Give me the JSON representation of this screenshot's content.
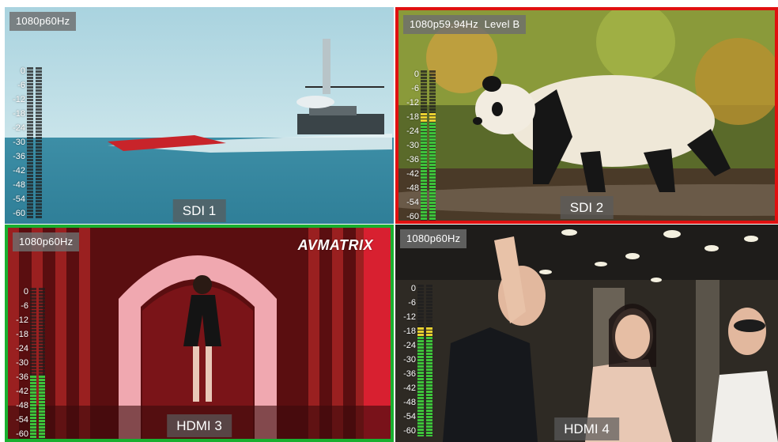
{
  "panes": [
    {
      "id": "sdi1",
      "format": "1080p60Hz",
      "source": "SDI 1",
      "audio_level": [
        0.0,
        0.0
      ]
    },
    {
      "id": "sdi2",
      "format": "1080p59.94Hz  Level B",
      "source": "SDI 2",
      "audio_level": [
        0.72,
        0.72
      ]
    },
    {
      "id": "hdmi3",
      "format": "1080p60Hz",
      "source": "HDMI 3",
      "audio_level": [
        0.42,
        0.42
      ],
      "logo": "AVMATRIX"
    },
    {
      "id": "hdmi4",
      "format": "1080p60Hz",
      "source": "HDMI 4",
      "audio_level": [
        0.72,
        0.72
      ]
    }
  ],
  "meter": {
    "scale": [
      "0",
      "-6",
      "-12",
      "-18",
      "-24",
      "-30",
      "-36",
      "-42",
      "-48",
      "-54",
      "-60"
    ]
  },
  "colors": {
    "active_program": "#e01010",
    "active_preview": "#18b030",
    "meter_green": "#3ec23a",
    "meter_yellow": "#e8d030"
  }
}
